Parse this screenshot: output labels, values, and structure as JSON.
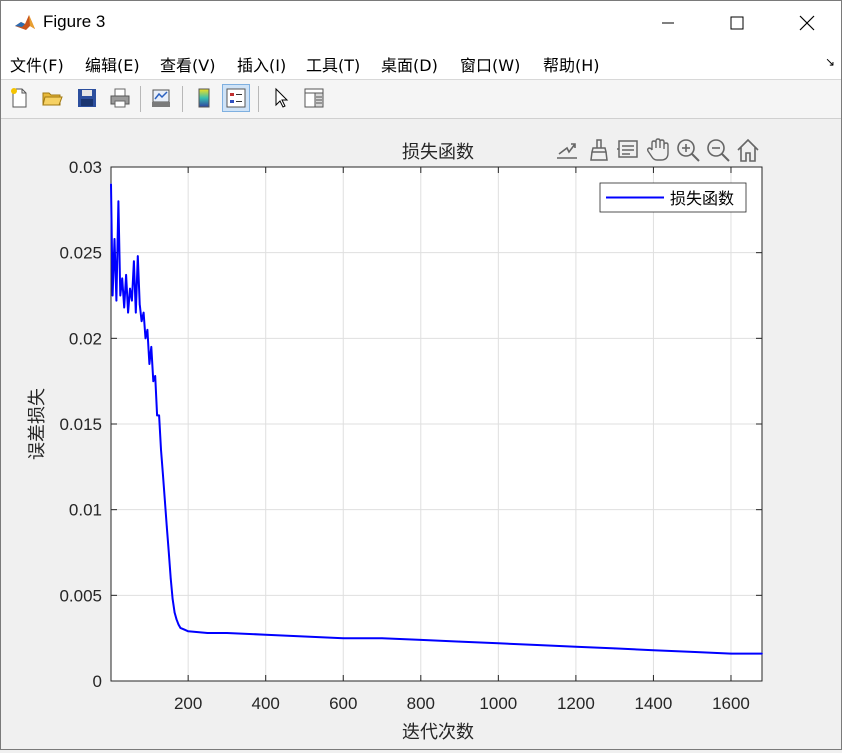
{
  "window": {
    "title": "Figure 3",
    "controls": {
      "minimize": "minimize",
      "maximize": "maximize",
      "close": "close"
    }
  },
  "menu": [
    "文件(F)",
    "编辑(E)",
    "查看(V)",
    "插入(I)",
    "工具(T)",
    "桌面(D)",
    "窗口(W)",
    "帮助(H)"
  ],
  "toolbar": {
    "buttons": [
      "new-figure-icon",
      "open-file-icon",
      "save-icon",
      "print-icon",
      "link-plot-icon",
      "colorbar-icon",
      "legend-icon",
      "edit-plot-arrow-icon",
      "property-inspector-icon"
    ],
    "active": "legend-icon"
  },
  "axes_toolbar": [
    "export-icon",
    "brush-icon",
    "data-tips-icon",
    "pan-hand-icon",
    "zoom-in-icon",
    "zoom-out-icon",
    "home-icon"
  ],
  "chart_data": {
    "type": "line",
    "title": "损失函数",
    "xlabel": "迭代次数",
    "ylabel": "误差损失",
    "xlim": [
      1,
      1680
    ],
    "ylim": [
      0,
      0.03
    ],
    "xticks": [
      200,
      400,
      600,
      800,
      1000,
      1200,
      1400,
      1600
    ],
    "xtick_labels": [
      "200",
      "400",
      "600",
      "800",
      "1000",
      "1200",
      "1400",
      "1600"
    ],
    "yticks": [
      0,
      0.005,
      0.01,
      0.015,
      0.02,
      0.025,
      0.03
    ],
    "ytick_labels": [
      "0",
      "0.005",
      "0.01",
      "0.015",
      "0.02",
      "0.025",
      "0.03"
    ],
    "grid": true,
    "legend": {
      "position": "top-right",
      "entries": [
        "损失函数"
      ]
    },
    "series": [
      {
        "name": "损失函数",
        "color": "#0000ff",
        "x": [
          1,
          5,
          10,
          15,
          20,
          25,
          30,
          35,
          40,
          45,
          50,
          55,
          60,
          65,
          70,
          75,
          80,
          85,
          90,
          95,
          100,
          105,
          110,
          115,
          120,
          125,
          130,
          135,
          140,
          145,
          150,
          155,
          160,
          165,
          170,
          175,
          180,
          190,
          200,
          250,
          300,
          400,
          500,
          600,
          700,
          800,
          900,
          1000,
          1100,
          1200,
          1300,
          1400,
          1500,
          1600,
          1680
        ],
        "y": [
          0.029,
          0.0225,
          0.0258,
          0.0222,
          0.028,
          0.0225,
          0.0235,
          0.0218,
          0.0237,
          0.0215,
          0.0229,
          0.0222,
          0.0245,
          0.0215,
          0.0248,
          0.022,
          0.021,
          0.0215,
          0.02,
          0.0205,
          0.0185,
          0.0195,
          0.0175,
          0.0178,
          0.0155,
          0.0155,
          0.0135,
          0.012,
          0.0105,
          0.009,
          0.0075,
          0.006,
          0.0048,
          0.004,
          0.0036,
          0.0033,
          0.0031,
          0.003,
          0.0029,
          0.0028,
          0.0028,
          0.0027,
          0.0026,
          0.0025,
          0.0025,
          0.0024,
          0.0023,
          0.0022,
          0.0021,
          0.002,
          0.0019,
          0.0018,
          0.0017,
          0.0016,
          0.0016
        ]
      }
    ]
  }
}
